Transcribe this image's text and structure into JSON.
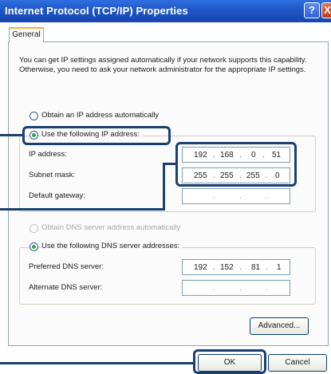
{
  "window": {
    "title": "Internet Protocol (TCP/IP) Properties",
    "help_glyph": "?",
    "close_glyph": "X"
  },
  "tabs": [
    {
      "label": "General"
    }
  ],
  "intro": "You can get IP settings assigned automatically if your network supports this capability. Otherwise, you need to ask your network administrator for the appropriate IP settings.",
  "ip_section": {
    "auto_label": "Obtain an IP address automatically",
    "manual_label": "Use the following IP address:",
    "selected": "manual",
    "fields": [
      {
        "label": "IP address:",
        "octets": [
          "192",
          "168",
          "0",
          "51"
        ]
      },
      {
        "label": "Subnet mask:",
        "octets": [
          "255",
          "255",
          "255",
          "0"
        ]
      },
      {
        "label": "Default gateway:",
        "octets": [
          "",
          "",
          "",
          ""
        ]
      }
    ]
  },
  "dns_section": {
    "auto_label": "Obtain DNS server address automatically",
    "manual_label": "Use the following DNS server addresses:",
    "selected": "manual",
    "fields": [
      {
        "label": "Preferred DNS server:",
        "octets": [
          "192",
          "152",
          "81",
          "1"
        ]
      },
      {
        "label": "Alternate DNS server:",
        "octets": [
          "",
          "",
          "",
          ""
        ]
      }
    ]
  },
  "buttons": {
    "advanced": "Advanced...",
    "ok": "OK",
    "cancel": "Cancel"
  },
  "colors": {
    "titlebar": "#1f56c8",
    "highlight": "#1a4070",
    "radio_selected": "#3aa53a"
  }
}
